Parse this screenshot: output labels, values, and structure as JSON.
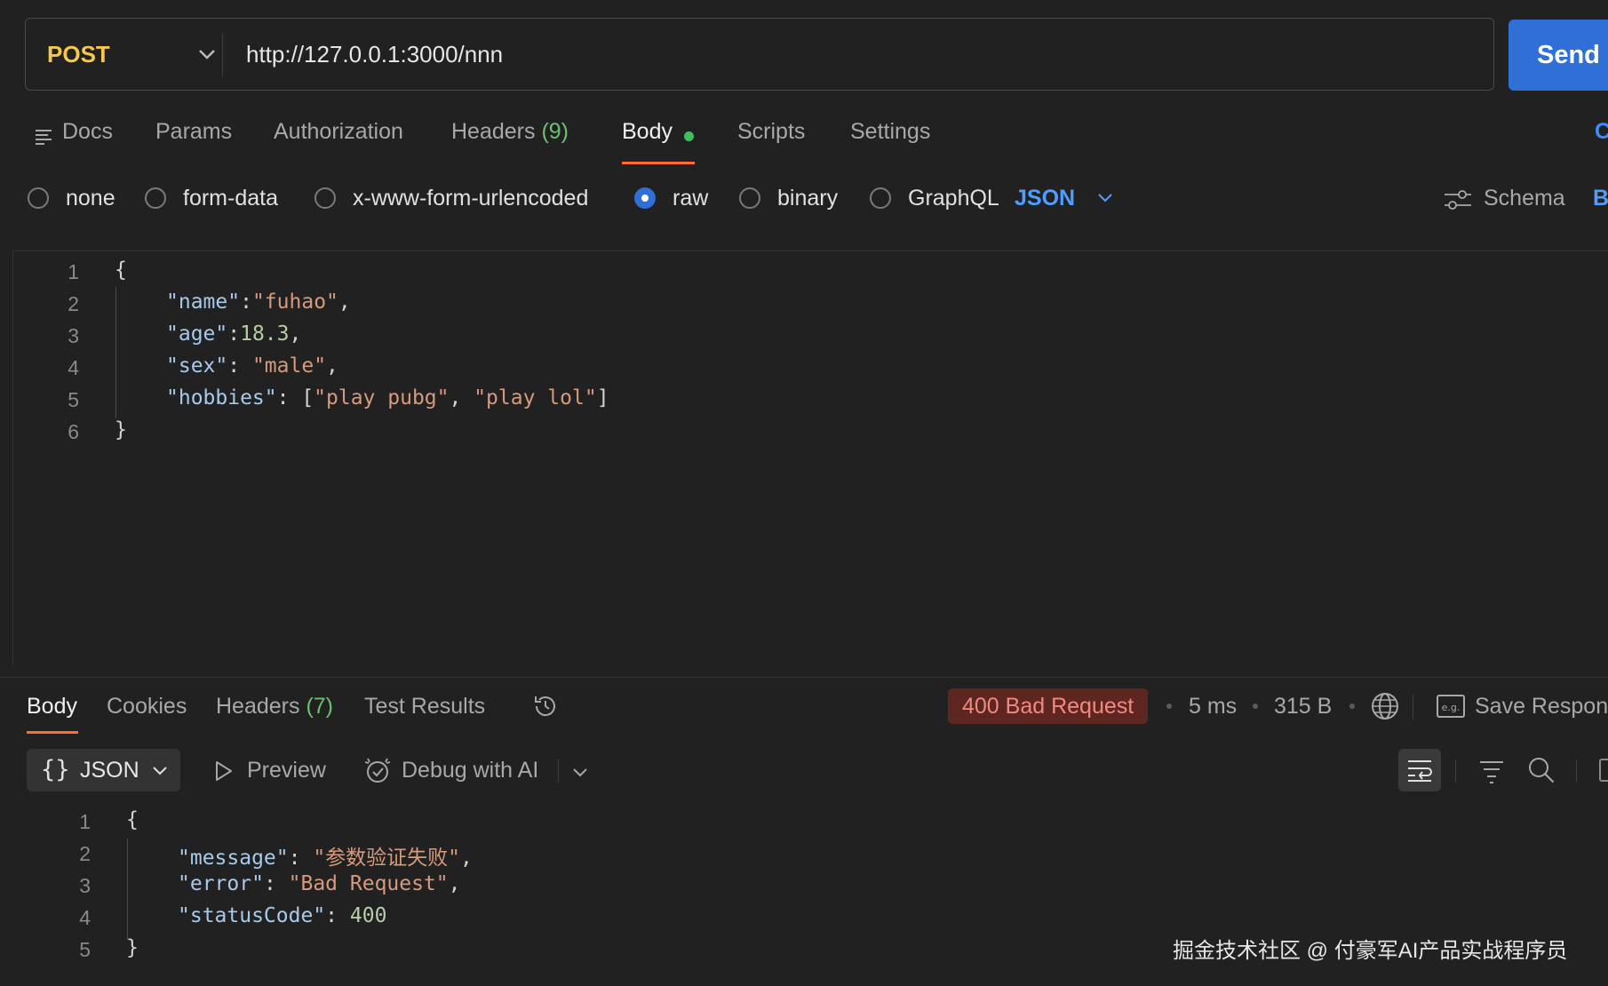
{
  "request": {
    "method": "POST",
    "url": "http://127.0.0.1:3000/nnn",
    "send_label": "Send",
    "tabs": [
      {
        "label": "Docs"
      },
      {
        "label": "Params"
      },
      {
        "label": "Authorization"
      },
      {
        "label": "Headers",
        "count": "(9)"
      },
      {
        "label": "Body",
        "active": true
      },
      {
        "label": "Scripts"
      },
      {
        "label": "Settings"
      }
    ],
    "tabs_right_cut": "C",
    "body_types": [
      "none",
      "form-data",
      "x-www-form-urlencoded",
      "raw",
      "binary",
      "GraphQL"
    ],
    "selected_body_type": "raw",
    "language": "JSON",
    "schema_label": "Schema",
    "schema_right_cut": "B",
    "code_lines": [
      "1",
      "2",
      "3",
      "4",
      "5",
      "6"
    ],
    "code": {
      "l1": "{",
      "l2_key": "\"name\"",
      "l2_sep": ":",
      "l2_val": "\"fuhao\"",
      "l2_end": ",",
      "l3_key": "\"age\"",
      "l3_sep": ":",
      "l3_val": "18.3",
      "l3_end": ",",
      "l4_key": "\"sex\"",
      "l4_sep": ": ",
      "l4_val": "\"male\"",
      "l4_end": ",",
      "l5_key": "\"hobbies\"",
      "l5_sep": ": [",
      "l5_val1": "\"play pubg\"",
      "l5_mid": ", ",
      "l5_val2": "\"play lol\"",
      "l5_end": "]",
      "l6": "}"
    }
  },
  "response": {
    "tabs": [
      {
        "label": "Body",
        "active": true
      },
      {
        "label": "Cookies"
      },
      {
        "label": "Headers",
        "count": "(7)"
      },
      {
        "label": "Test Results"
      }
    ],
    "status": "400 Bad Request",
    "time": "5 ms",
    "size": "315 B",
    "save_label": "Save Respon",
    "format": "JSON",
    "preview_label": "Preview",
    "debug_label": "Debug with AI",
    "code_lines": [
      "1",
      "2",
      "3",
      "4",
      "5"
    ],
    "code": {
      "l1": "{",
      "l2_key": "\"message\"",
      "l2_sep": ": ",
      "l2_val": "\"参数验证失败\"",
      "l2_end": ",",
      "l3_key": "\"error\"",
      "l3_sep": ": ",
      "l3_val": "\"Bad Request\"",
      "l3_end": ",",
      "l4_key": "\"statusCode\"",
      "l4_sep": ": ",
      "l4_val": "400",
      "l5": "}"
    }
  },
  "watermark": "掘金技术社区 @ 付豪军AI产品实战程序员",
  "colors": {
    "accent_tab": "#ff6c37",
    "send_button": "#2f6fd6",
    "method": "#f5c84c",
    "status_badge_bg": "#5e2620",
    "status_badge_text": "#f08a80"
  }
}
